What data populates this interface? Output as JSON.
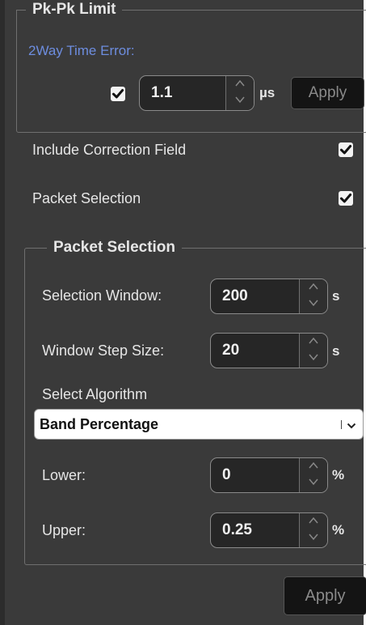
{
  "pkpk": {
    "legend": "Pk-Pk Limit",
    "label": "2Way Time Error:",
    "enabled": true,
    "value": "1.1",
    "unit": "µs",
    "apply_label": "Apply"
  },
  "options": {
    "include_correction": {
      "label": "Include Correction Field",
      "checked": true
    },
    "packet_selection": {
      "label": "Packet Selection",
      "checked": true
    }
  },
  "packet_selection": {
    "legend": "Packet Selection",
    "selection_window": {
      "label": "Selection Window:",
      "value": "200",
      "unit": "s"
    },
    "window_step": {
      "label": "Window Step Size:",
      "value": "20",
      "unit": "s"
    },
    "algorithm": {
      "label": "Select Algorithm",
      "selected": "Band Percentage"
    },
    "lower": {
      "label": "Lower:",
      "value": "0",
      "unit": "%"
    },
    "upper": {
      "label": "Upper:",
      "value": "0.25",
      "unit": "%"
    }
  },
  "footer": {
    "apply_label": "Apply"
  },
  "colors": {
    "panel_bg": "#3a3a3a",
    "accent_label": "#6d8ddf",
    "button_bg": "#141414"
  }
}
